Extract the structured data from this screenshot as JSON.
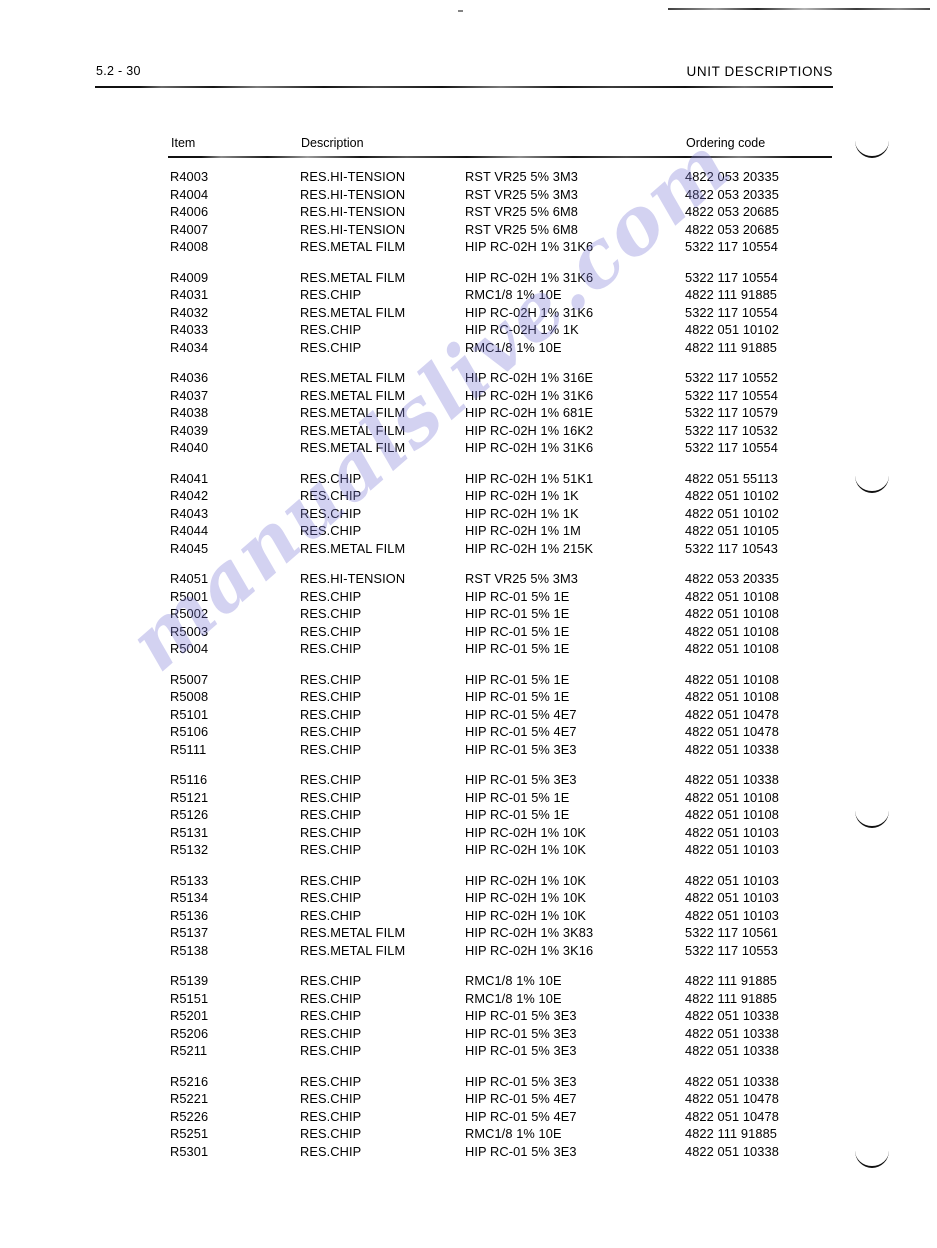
{
  "header": {
    "page_number": "5.2 - 30",
    "title": "UNIT DESCRIPTIONS"
  },
  "watermark": {
    "text": "manualslive.com"
  },
  "table": {
    "columns": {
      "item": "Item",
      "description": "Description",
      "ordering_code": "Ordering code"
    },
    "blocks": [
      [
        {
          "item": "R4003",
          "description": "RES.HI-TENSION",
          "value": "RST VR25 5% 3M3",
          "ordering_code": "4822 053 20335"
        },
        {
          "item": "R4004",
          "description": "RES.HI-TENSION",
          "value": "RST VR25 5% 3M3",
          "ordering_code": "4822 053 20335"
        },
        {
          "item": "R4006",
          "description": "RES.HI-TENSION",
          "value": "RST VR25 5% 6M8",
          "ordering_code": "4822 053 20685"
        },
        {
          "item": "R4007",
          "description": "RES.HI-TENSION",
          "value": "RST VR25 5% 6M8",
          "ordering_code": "4822 053 20685"
        },
        {
          "item": "R4008",
          "description": "RES.METAL FILM",
          "value": "HIP RC-02H 1% 31K6",
          "ordering_code": "5322 117 10554"
        }
      ],
      [
        {
          "item": "R4009",
          "description": "RES.METAL FILM",
          "value": "HIP RC-02H 1% 31K6",
          "ordering_code": "5322 117 10554"
        },
        {
          "item": "R4031",
          "description": "RES.CHIP",
          "value": "RMC1/8 1% 10E",
          "ordering_code": "4822 111 91885"
        },
        {
          "item": "R4032",
          "description": "RES.METAL FILM",
          "value": "HIP RC-02H 1% 31K6",
          "ordering_code": "5322 117 10554"
        },
        {
          "item": "R4033",
          "description": "RES.CHIP",
          "value": "HIP RC-02H 1% 1K",
          "ordering_code": "4822 051 10102"
        },
        {
          "item": "R4034",
          "description": "RES.CHIP",
          "value": "RMC1/8 1% 10E",
          "ordering_code": "4822 111 91885"
        }
      ],
      [
        {
          "item": "R4036",
          "description": "RES.METAL FILM",
          "value": "HIP RC-02H 1% 316E",
          "ordering_code": "5322 117 10552"
        },
        {
          "item": "R4037",
          "description": "RES.METAL FILM",
          "value": "HIP RC-02H 1% 31K6",
          "ordering_code": "5322 117 10554"
        },
        {
          "item": "R4038",
          "description": "RES.METAL FILM",
          "value": "HIP RC-02H 1% 681E",
          "ordering_code": "5322 117 10579"
        },
        {
          "item": "R4039",
          "description": "RES.METAL FILM",
          "value": "HIP RC-02H 1% 16K2",
          "ordering_code": "5322 117 10532"
        },
        {
          "item": "R4040",
          "description": "RES.METAL FILM",
          "value": "HIP RC-02H 1% 31K6",
          "ordering_code": "5322 117 10554"
        }
      ],
      [
        {
          "item": "R4041",
          "description": "RES.CHIP",
          "value": "HIP RC-02H 1% 51K1",
          "ordering_code": "4822 051 55113"
        },
        {
          "item": "R4042",
          "description": "RES.CHIP",
          "value": "HIP RC-02H 1% 1K",
          "ordering_code": "4822 051 10102"
        },
        {
          "item": "R4043",
          "description": "RES.CHIP",
          "value": "HIP RC-02H 1% 1K",
          "ordering_code": "4822 051 10102"
        },
        {
          "item": "R4044",
          "description": "RES.CHIP",
          "value": "HIP RC-02H 1% 1M",
          "ordering_code": "4822 051 10105"
        },
        {
          "item": "R4045",
          "description": "RES.METAL FILM",
          "value": "HIP RC-02H 1% 215K",
          "ordering_code": "5322 117 10543"
        }
      ],
      [
        {
          "item": "R4051",
          "description": "RES.HI-TENSION",
          "value": "RST VR25 5% 3M3",
          "ordering_code": "4822 053 20335"
        },
        {
          "item": "R5001",
          "description": "RES.CHIP",
          "value": "HIP RC-01 5% 1E",
          "ordering_code": "4822 051 10108"
        },
        {
          "item": "R5002",
          "description": "RES.CHIP",
          "value": "HIP RC-01 5% 1E",
          "ordering_code": "4822 051 10108"
        },
        {
          "item": "R5003",
          "description": "RES.CHIP",
          "value": "HIP RC-01 5% 1E",
          "ordering_code": "4822 051 10108"
        },
        {
          "item": "R5004",
          "description": "RES.CHIP",
          "value": "HIP RC-01 5% 1E",
          "ordering_code": "4822 051 10108"
        }
      ],
      [
        {
          "item": "R5007",
          "description": "RES.CHIP",
          "value": "HIP RC-01 5% 1E",
          "ordering_code": "4822 051 10108"
        },
        {
          "item": "R5008",
          "description": "RES.CHIP",
          "value": "HIP RC-01 5% 1E",
          "ordering_code": "4822 051 10108"
        },
        {
          "item": "R5101",
          "description": "RES.CHIP",
          "value": "HIP RC-01 5% 4E7",
          "ordering_code": "4822 051 10478"
        },
        {
          "item": "R5106",
          "description": "RES.CHIP",
          "value": "HIP RC-01 5% 4E7",
          "ordering_code": "4822 051 10478"
        },
        {
          "item": "R5111",
          "description": "RES.CHIP",
          "value": "HIP RC-01 5% 3E3",
          "ordering_code": "4822 051 10338"
        }
      ],
      [
        {
          "item": "R5116",
          "description": "RES.CHIP",
          "value": "HIP RC-01 5% 3E3",
          "ordering_code": "4822 051 10338"
        },
        {
          "item": "R5121",
          "description": "RES.CHIP",
          "value": "HIP RC-01 5% 1E",
          "ordering_code": "4822 051 10108"
        },
        {
          "item": "R5126",
          "description": "RES.CHIP",
          "value": "HIP RC-01 5% 1E",
          "ordering_code": "4822 051 10108"
        },
        {
          "item": "R5131",
          "description": "RES.CHIP",
          "value": "HIP RC-02H 1% 10K",
          "ordering_code": "4822 051 10103"
        },
        {
          "item": "R5132",
          "description": "RES.CHIP",
          "value": "HIP RC-02H 1% 10K",
          "ordering_code": "4822 051 10103"
        }
      ],
      [
        {
          "item": "R5133",
          "description": "RES.CHIP",
          "value": "HIP RC-02H 1% 10K",
          "ordering_code": "4822 051 10103"
        },
        {
          "item": "R5134",
          "description": "RES.CHIP",
          "value": "HIP RC-02H 1% 10K",
          "ordering_code": "4822 051 10103"
        },
        {
          "item": "R5136",
          "description": "RES.CHIP",
          "value": "HIP RC-02H 1% 10K",
          "ordering_code": "4822 051 10103"
        },
        {
          "item": "R5137",
          "description": "RES.METAL FILM",
          "value": "HIP RC-02H 1% 3K83",
          "ordering_code": "5322 117 10561"
        },
        {
          "item": "R5138",
          "description": "RES.METAL FILM",
          "value": "HIP RC-02H 1% 3K16",
          "ordering_code": "5322 117 10553"
        }
      ],
      [
        {
          "item": "R5139",
          "description": "RES.CHIP",
          "value": "RMC1/8 1% 10E",
          "ordering_code": "4822 111 91885"
        },
        {
          "item": "R5151",
          "description": "RES.CHIP",
          "value": "RMC1/8 1% 10E",
          "ordering_code": "4822 111 91885"
        },
        {
          "item": "R5201",
          "description": "RES.CHIP",
          "value": "HIP RC-01 5% 3E3",
          "ordering_code": "4822 051 10338"
        },
        {
          "item": "R5206",
          "description": "RES.CHIP",
          "value": "HIP RC-01 5% 3E3",
          "ordering_code": "4822 051 10338"
        },
        {
          "item": "R5211",
          "description": "RES.CHIP",
          "value": "HIP RC-01 5% 3E3",
          "ordering_code": "4822 051 10338"
        }
      ],
      [
        {
          "item": "R5216",
          "description": "RES.CHIP",
          "value": "HIP RC-01 5% 3E3",
          "ordering_code": "4822 051 10338"
        },
        {
          "item": "R5221",
          "description": "RES.CHIP",
          "value": "HIP RC-01 5% 4E7",
          "ordering_code": "4822 051 10478"
        },
        {
          "item": "R5226",
          "description": "RES.CHIP",
          "value": "HIP RC-01 5% 4E7",
          "ordering_code": "4822 051 10478"
        },
        {
          "item": "R5251",
          "description": "RES.CHIP",
          "value": "RMC1/8 1% 10E",
          "ordering_code": "4822 111 91885"
        },
        {
          "item": "R5301",
          "description": "RES.CHIP",
          "value": "HIP RC-01 5% 3E3",
          "ordering_code": "4822 051 10338"
        }
      ]
    ]
  },
  "binding_marks": [
    140,
    475,
    810,
    1150
  ]
}
